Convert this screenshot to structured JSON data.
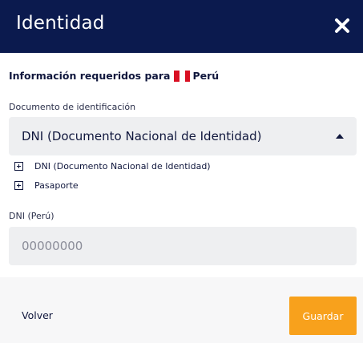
{
  "header": {
    "title": "Identidad",
    "close_icon": "close-x-icon"
  },
  "requirements": {
    "prefix": "Información requeridos para",
    "country": "Perú",
    "flag_icon": "peru-flag-icon"
  },
  "document": {
    "label": "Documento de identificación",
    "selected": "DNI (Documento Nacional de Identidad)",
    "options": [
      "DNI (Documento Nacional de Identidad)",
      "Pasaporte"
    ],
    "caret_icon": "caret-up-icon",
    "option_icon": "plus-square-icon"
  },
  "dni": {
    "label": "DNI (Perú)",
    "placeholder": "00000000",
    "value": ""
  },
  "footer": {
    "back_label": "Volver",
    "save_label": "Guardar"
  },
  "colors": {
    "header_bg": "#0b1a4e",
    "accent": "#f8a11c",
    "field_bg": "#eeeff1",
    "text": "#10173d"
  }
}
